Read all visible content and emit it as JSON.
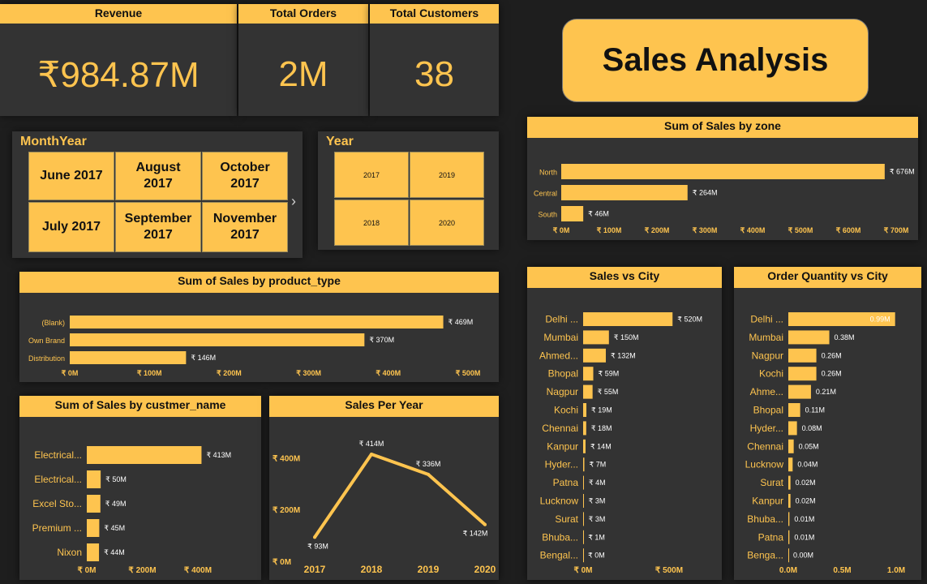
{
  "kpis": {
    "revenue": {
      "label": "Revenue",
      "value": "₹984.87M"
    },
    "orders": {
      "label": "Total Orders",
      "value": "2M"
    },
    "customers": {
      "label": "Total Customers",
      "value": "38"
    }
  },
  "dashboard_title": "Sales Analysis",
  "month_slicer": {
    "title": "MonthYear",
    "items": [
      "June 2017",
      "August 2017",
      "October 2017",
      "July 2017",
      "September 2017",
      "November 2017"
    ]
  },
  "year_slicer": {
    "title": "Year",
    "items": [
      "2017",
      "2019",
      "2018",
      "2020"
    ]
  },
  "colors": {
    "accent": "#fec44f",
    "panel": "#333333",
    "background": "#1e1e1e"
  },
  "icons": {
    "slicer_next": "chevron-right-icon"
  },
  "chart_data": [
    {
      "id": "zone",
      "type": "bar",
      "orientation": "horizontal",
      "title": "Sum of Sales by zone",
      "categories": [
        "North",
        "Central",
        "South"
      ],
      "values": [
        676,
        264,
        46
      ],
      "labels": [
        "₹ 676M",
        "₹ 264M",
        "₹ 46M"
      ],
      "xlim": [
        0,
        700
      ],
      "ticks": [
        "₹ 0M",
        "₹ 100M",
        "₹ 200M",
        "₹ 300M",
        "₹ 400M",
        "₹ 500M",
        "₹ 600M",
        "₹ 700M"
      ]
    },
    {
      "id": "product",
      "type": "bar",
      "orientation": "horizontal",
      "title": "Sum of Sales by product_type",
      "categories": [
        "(Blank)",
        "Own Brand",
        "Distribution"
      ],
      "values": [
        469,
        370,
        146
      ],
      "labels": [
        "₹ 469M",
        "₹ 370M",
        "₹ 146M"
      ],
      "xlim": [
        0,
        500
      ],
      "ticks": [
        "₹ 0M",
        "₹ 100M",
        "₹ 200M",
        "₹ 300M",
        "₹ 400M",
        "₹ 500M"
      ]
    },
    {
      "id": "customer",
      "type": "bar",
      "orientation": "horizontal",
      "title": "Sum of Sales by custmer_name",
      "categories": [
        "Electrical...",
        "Electrical...",
        "Excel Sto...",
        "Premium ...",
        "Nixon"
      ],
      "values": [
        413,
        50,
        49,
        45,
        44
      ],
      "labels": [
        "₹ 413M",
        "₹ 50M",
        "₹ 49M",
        "₹ 45M",
        "₹ 44M"
      ],
      "xlim": [
        0,
        400
      ],
      "ticks": [
        "₹ 0M",
        "₹ 200M",
        "₹ 400M"
      ]
    },
    {
      "id": "year",
      "type": "line",
      "title": "Sales Per Year",
      "x": [
        "2017",
        "2018",
        "2019",
        "2020"
      ],
      "values": [
        93,
        414,
        336,
        142
      ],
      "labels": [
        "₹ 93M",
        "₹ 414M",
        "₹ 336M",
        "₹ 142M"
      ],
      "ylim": [
        0,
        400
      ],
      "yticks": [
        "₹ 0M",
        "₹ 200M",
        "₹ 400M"
      ]
    },
    {
      "id": "city_sales",
      "type": "bar",
      "orientation": "horizontal",
      "title": "Sales vs City",
      "categories": [
        "Delhi ...",
        "Mumbai",
        "Ahmed...",
        "Bhopal",
        "Nagpur",
        "Kochi",
        "Chennai",
        "Kanpur",
        "Hyder...",
        "Patna",
        "Lucknow",
        "Surat",
        "Bhuba...",
        "Bengal..."
      ],
      "values": [
        520,
        150,
        132,
        59,
        55,
        19,
        18,
        14,
        7,
        4,
        3,
        3,
        1,
        0
      ],
      "labels": [
        "₹ 520M",
        "₹ 150M",
        "₹ 132M",
        "₹ 59M",
        "₹ 55M",
        "₹ 19M",
        "₹ 18M",
        "₹ 14M",
        "₹ 7M",
        "₹ 4M",
        "₹ 3M",
        "₹ 3M",
        "₹ 1M",
        "₹ 0M"
      ],
      "xlim": [
        0,
        500
      ],
      "ticks": [
        "₹ 0M",
        "₹ 500M"
      ]
    },
    {
      "id": "city_qty",
      "type": "bar",
      "orientation": "horizontal",
      "title": "Order Quantity vs City",
      "categories": [
        "Delhi ...",
        "Mumbai",
        "Nagpur",
        "Kochi",
        "Ahme...",
        "Bhopal",
        "Hyder...",
        "Chennai",
        "Lucknow",
        "Surat",
        "Kanpur",
        "Bhuba...",
        "Patna",
        "Benga..."
      ],
      "values": [
        0.99,
        0.38,
        0.26,
        0.26,
        0.21,
        0.11,
        0.08,
        0.05,
        0.04,
        0.02,
        0.02,
        0.01,
        0.01,
        0.0
      ],
      "labels": [
        "0.99M",
        "0.38M",
        "0.26M",
        "0.26M",
        "0.21M",
        "0.11M",
        "0.08M",
        "0.05M",
        "0.04M",
        "0.02M",
        "0.02M",
        "0.01M",
        "0.01M",
        "0.00M"
      ],
      "xlim": [
        0,
        1.0
      ],
      "ticks": [
        "0.0M",
        "0.5M",
        "1.0M"
      ]
    }
  ]
}
